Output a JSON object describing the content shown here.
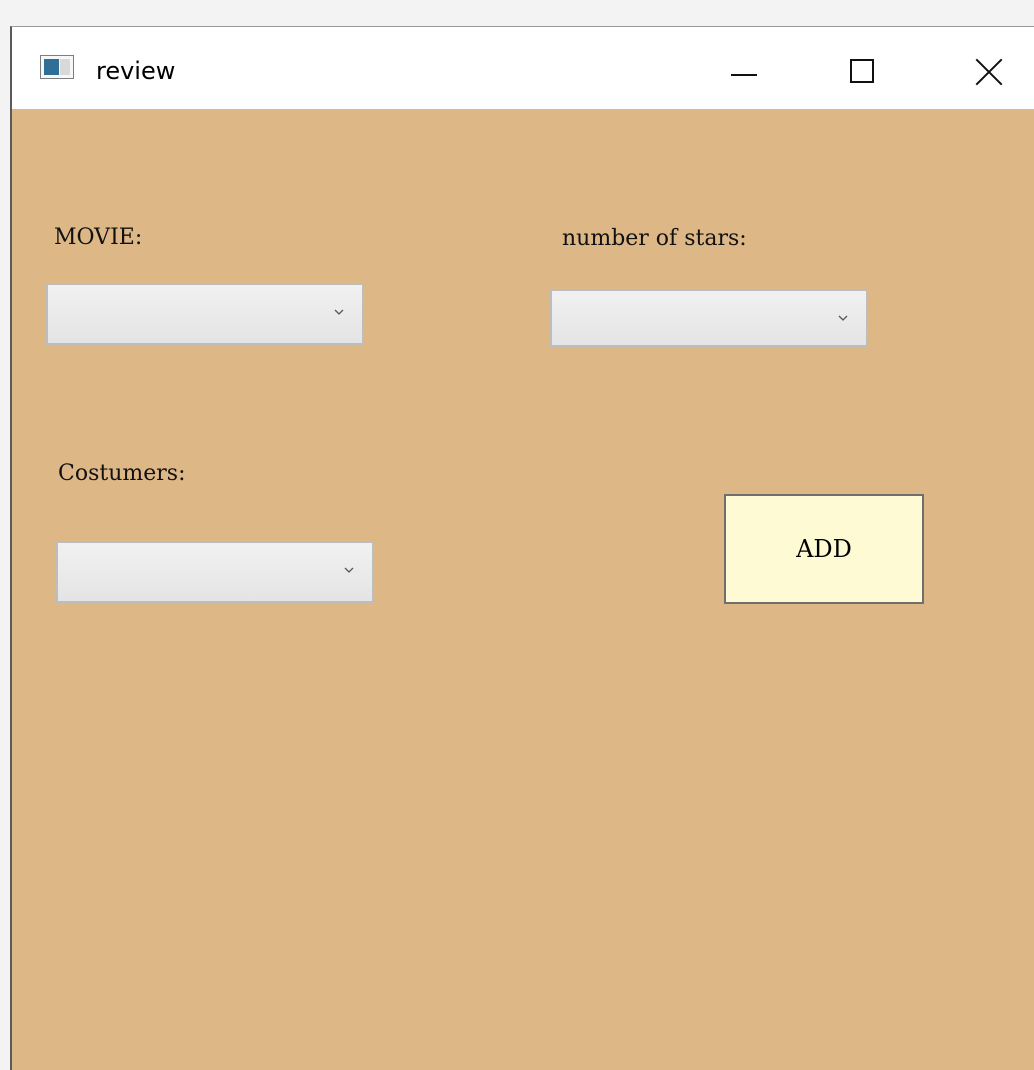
{
  "window": {
    "title": "review",
    "controls": [
      "minimize",
      "maximize",
      "close"
    ]
  },
  "form": {
    "movie_label": "MOVIE:",
    "stars_label": "number of stars:",
    "customers_label": "Costumers:",
    "movie_value": "",
    "stars_value": "",
    "customers_value": "",
    "add_label": "ADD"
  },
  "icons": {
    "app": "window-icon",
    "dropdown": "chevron-down-icon"
  },
  "colors": {
    "background": "#deb787",
    "button": "#fdfad4",
    "combo": "#e9e9e9"
  }
}
